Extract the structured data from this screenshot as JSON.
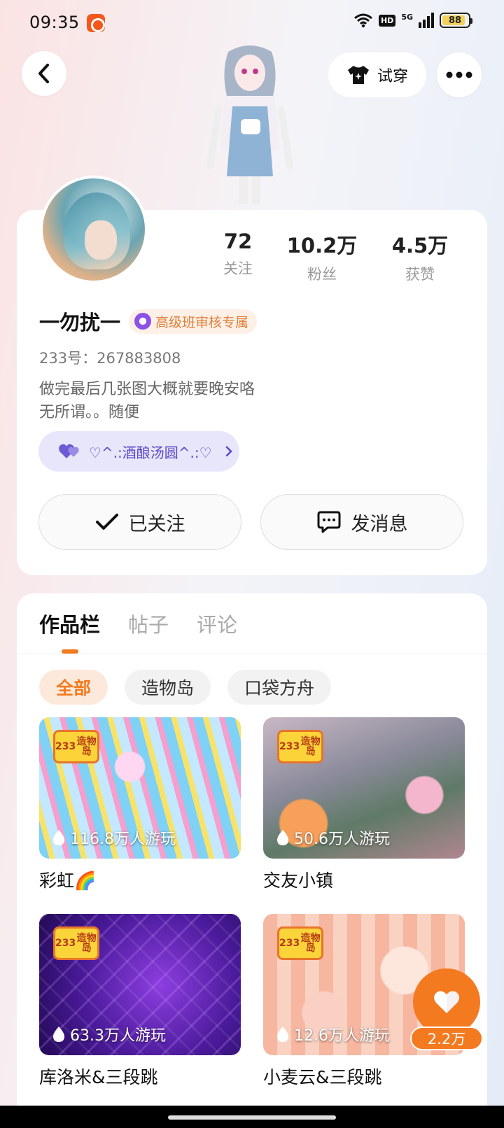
{
  "status_bar": {
    "time": "09:35",
    "hd": "HD",
    "network": "5G",
    "battery": "88"
  },
  "header": {
    "try_on_label": "试穿"
  },
  "profile": {
    "stats": [
      {
        "value": "72",
        "label": "关注"
      },
      {
        "value": "10.2万",
        "label": "粉丝"
      },
      {
        "value": "4.5万",
        "label": "获赞"
      }
    ],
    "username": "一勿扰一",
    "badge": "高级班审核专属",
    "id_label": "233号：",
    "id_value": "267883808",
    "bio_line1": "做完最后几张图大概就要晚安咯",
    "bio_line2": "无所谓。。随便",
    "fan_group": "♡^.:酒酿汤圆^.:♡",
    "follow_label": "已关注",
    "message_label": "发消息"
  },
  "works": {
    "tabs": [
      {
        "label": "作品栏",
        "active": true
      },
      {
        "label": "帖子",
        "active": false
      },
      {
        "label": "评论",
        "active": false
      }
    ],
    "chips": [
      {
        "label": "全部",
        "active": true
      },
      {
        "label": "造物岛",
        "active": false
      },
      {
        "label": "口袋方舟",
        "active": false
      }
    ],
    "logo_line1": "233",
    "logo_line2": "造物岛",
    "games": [
      {
        "title": "彩虹🌈",
        "plays": "116.8万人游玩"
      },
      {
        "title": "交友小镇",
        "plays": "50.6万人游玩"
      },
      {
        "title": "库洛米&三段跳",
        "plays": "63.3万人游玩"
      },
      {
        "title": "小麦云&三段跳",
        "plays": "12.6万人游玩"
      }
    ]
  },
  "like": {
    "count": "2.2万"
  },
  "colors": {
    "accent": "#f47a20",
    "fan_group_text": "#5a48c8",
    "badge_text": "#e0803a"
  }
}
